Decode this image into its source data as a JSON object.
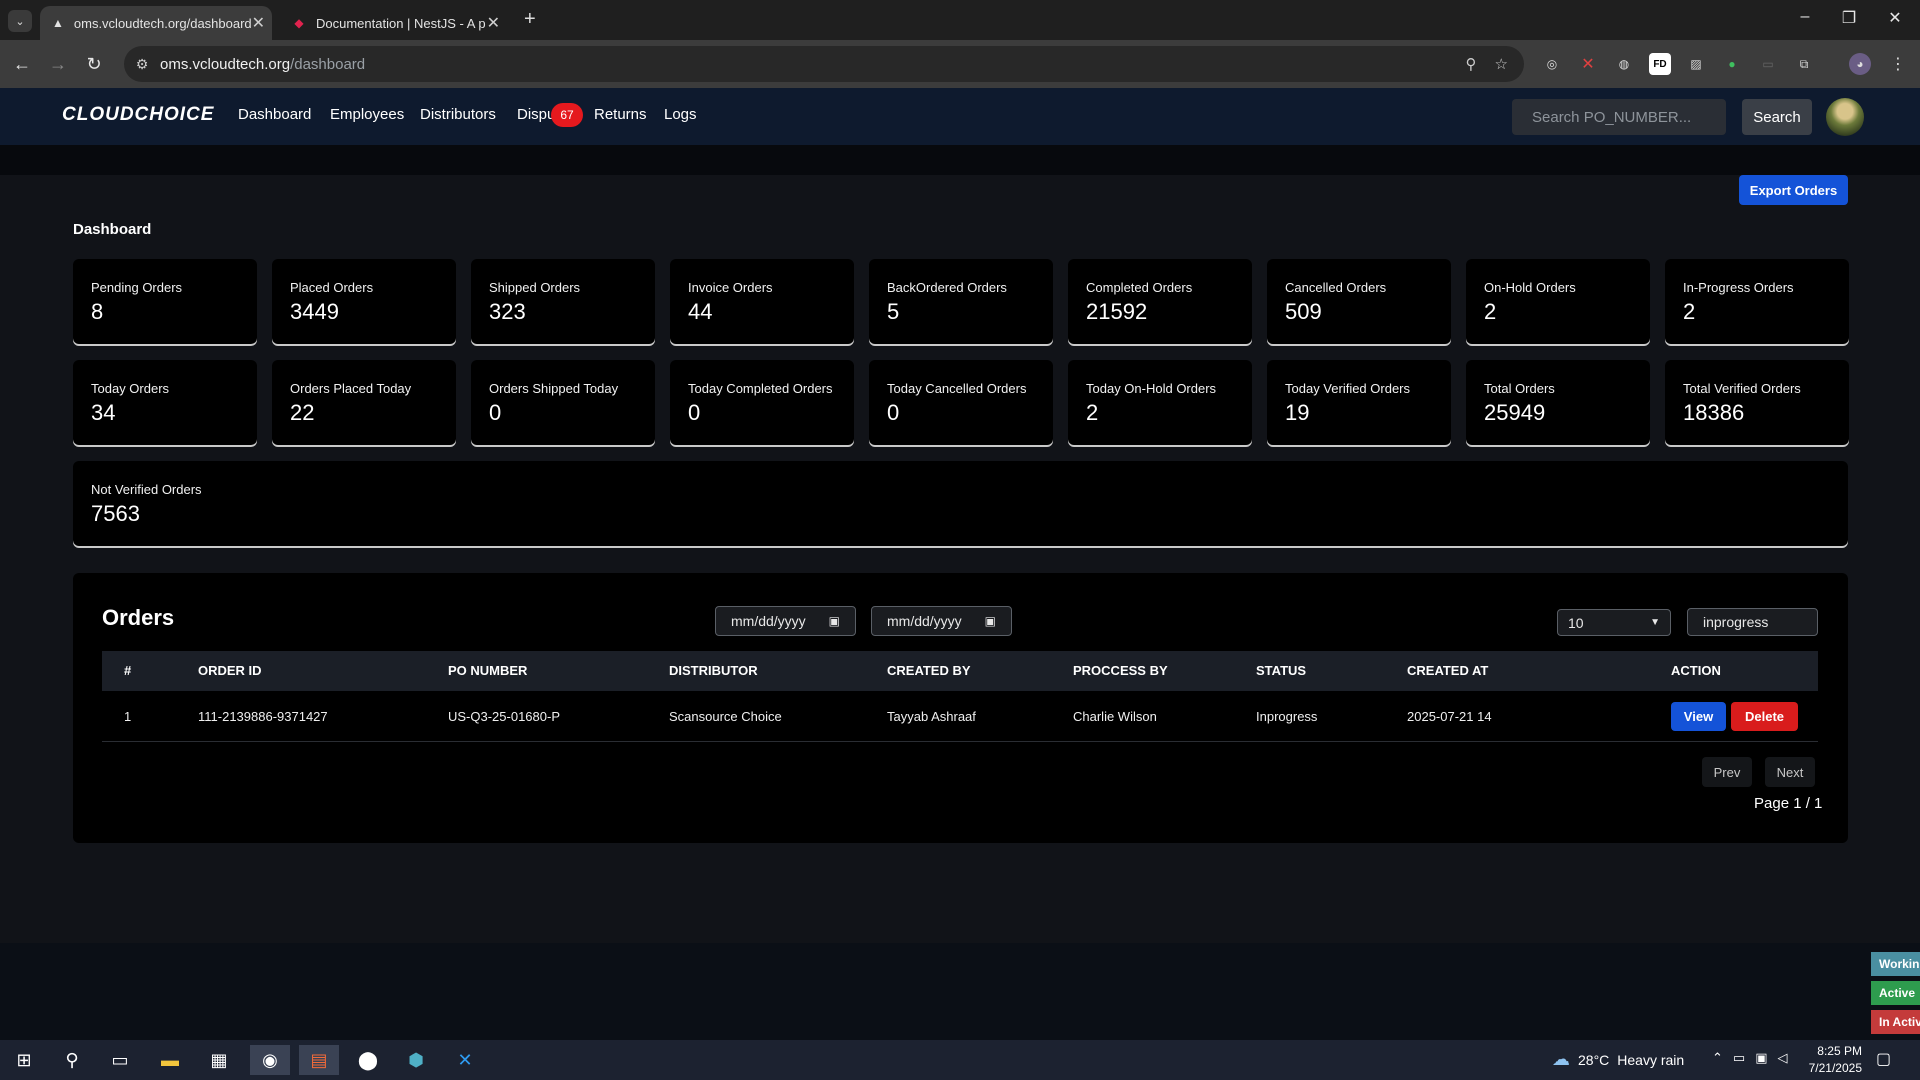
{
  "browser": {
    "tabs": [
      {
        "title": "oms.vcloudtech.org/dashboard",
        "active": true
      },
      {
        "title": "Documentation | NestJS - A pro",
        "active": false
      }
    ],
    "url_host": "oms.vcloudtech.org",
    "url_path": "/dashboard"
  },
  "header": {
    "logo": "CLOUDCHOICE",
    "nav": [
      "Dashboard",
      "Employees",
      "Distributors",
      "Dispu",
      "Returns",
      "Logs"
    ],
    "dispute_badge": "67",
    "search_placeholder": "Search PO_NUMBER...",
    "search_button": "Search"
  },
  "dashboard": {
    "export_button": "Export Orders",
    "title": "Dashboard",
    "row1": [
      {
        "label": "Pending Orders",
        "value": "8"
      },
      {
        "label": "Placed Orders",
        "value": "3449"
      },
      {
        "label": "Shipped Orders",
        "value": "323"
      },
      {
        "label": "Invoice Orders",
        "value": "44"
      },
      {
        "label": "BackOrdered Orders",
        "value": "5"
      },
      {
        "label": "Completed Orders",
        "value": "21592"
      },
      {
        "label": "Cancelled Orders",
        "value": "509"
      },
      {
        "label": "On-Hold Orders",
        "value": "2"
      },
      {
        "label": "In-Progress Orders",
        "value": "2"
      }
    ],
    "row2": [
      {
        "label": "Today Orders",
        "value": "34"
      },
      {
        "label": "Orders Placed Today",
        "value": "22"
      },
      {
        "label": "Orders Shipped Today",
        "value": "0"
      },
      {
        "label": "Today Completed Orders",
        "value": "0"
      },
      {
        "label": "Today Cancelled Orders",
        "value": "0"
      },
      {
        "label": "Today On-Hold Orders",
        "value": "2"
      },
      {
        "label": "Today Verified Orders",
        "value": "19"
      },
      {
        "label": "Total Orders",
        "value": "25949"
      },
      {
        "label": "Total Verified Orders",
        "value": "18386"
      }
    ],
    "not_verified": {
      "label": "Not Verified Orders",
      "value": "7563"
    }
  },
  "orders": {
    "title": "Orders",
    "date_from": "mm/dd/yyyy",
    "date_to": "mm/dd/yyyy",
    "per_page": "10",
    "status_filter": "inprogress",
    "columns": [
      "#",
      "ORDER ID",
      "PO NUMBER",
      "DISTRIBUTOR",
      "CREATED BY",
      "PROCCESS BY",
      "STATUS",
      "CREATED AT",
      "ACTION"
    ],
    "rows": [
      {
        "num": "1",
        "order_id": "111-2139886-9371427",
        "po_number": "US-Q3-25-01680-P",
        "distributor": "Scansource Choice",
        "created_by": "Tayyab Ashraaf",
        "process_by": "Charlie Wilson",
        "status": "Inprogress",
        "created_at": "2025-07-21 14"
      }
    ],
    "view_label": "View",
    "delete_label": "Delete",
    "prev_label": "Prev",
    "next_label": "Next",
    "page_info": "Page 1 / 1"
  },
  "side_tags": [
    {
      "label": "Working",
      "color": "#4a8fa1"
    },
    {
      "label": "Active",
      "color": "#2e9c4e"
    },
    {
      "label": "In Active",
      "color": "#c43b3b"
    }
  ],
  "taskbar": {
    "weather_temp": "28°C",
    "weather_desc": "Heavy rain",
    "time": "8:25 PM",
    "date": "7/21/2025"
  }
}
